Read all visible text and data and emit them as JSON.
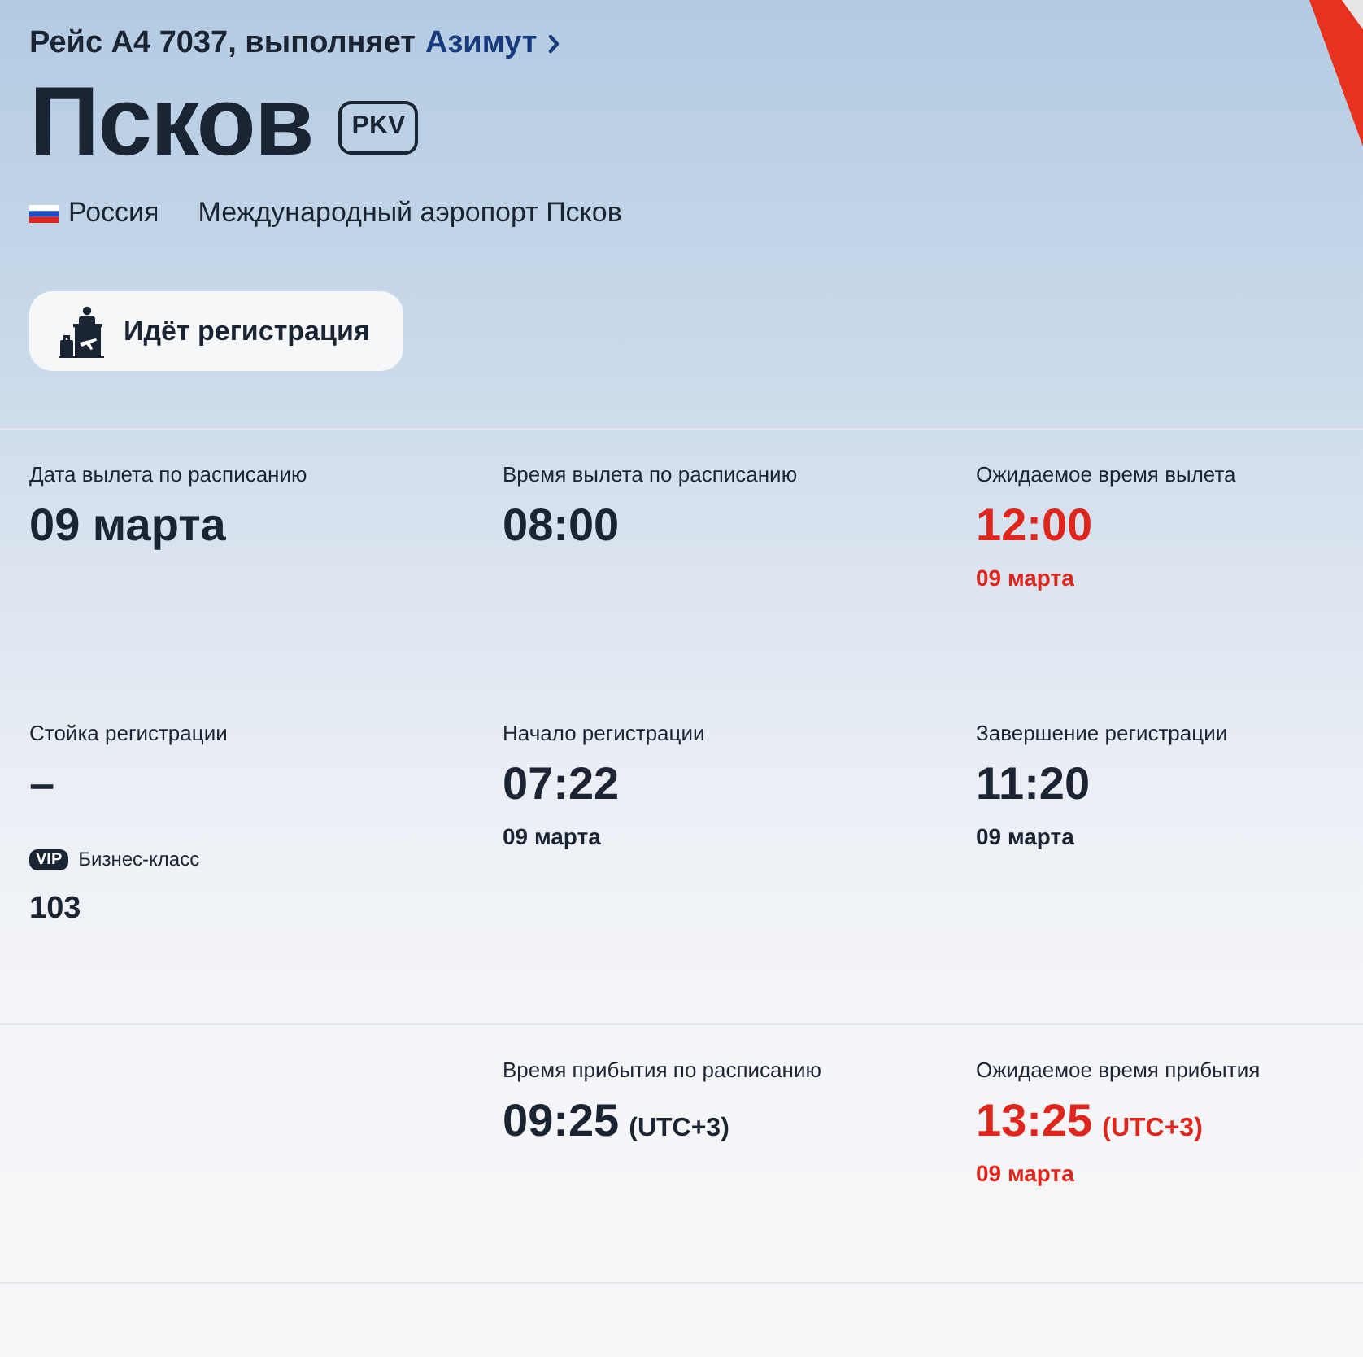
{
  "flight": {
    "text": "Рейс А4 7037, выполняет",
    "operator": "Азимут"
  },
  "city": {
    "name": "Псков",
    "code": "PKV"
  },
  "location": {
    "country": "Россия",
    "airport": "Международный аэропорт Псков"
  },
  "status": {
    "label": "Идёт регистрация"
  },
  "sections": [
    {
      "cells": [
        {
          "kind": "info",
          "label": "Дата вылета по расписанию",
          "value": "09 марта",
          "delayed": false
        },
        {
          "kind": "info",
          "label": "Время вылета по расписанию",
          "value": "08:00",
          "delayed": false
        },
        {
          "kind": "info",
          "label": "Ожидаемое время вылета",
          "value": "12:00",
          "date": "09 марта",
          "delayed": true
        }
      ]
    },
    {
      "cells": [
        {
          "kind": "info",
          "label": "Стойка регистрации",
          "value": "–",
          "delayed": false,
          "class_counter": {
            "badge": "VIP",
            "label": "Бизнес-класс",
            "value": "103"
          }
        },
        {
          "kind": "info",
          "label": "Начало регистрации",
          "value": "07:22",
          "date": "09 марта",
          "delayed": false
        },
        {
          "kind": "info",
          "label": "Завершение регистрации",
          "value": "11:20",
          "date": "09 марта",
          "delayed": false
        }
      ]
    },
    {
      "cells": [
        {
          "kind": "empty"
        },
        {
          "kind": "info",
          "label": "Время прибытия по расписанию",
          "value": "09:25",
          "timezone": "(UTC+3)",
          "delayed": false
        },
        {
          "kind": "info",
          "label": "Ожидаемое время прибытия",
          "value": "13:25",
          "timezone": "(UTC+3)",
          "date": "09 марта",
          "delayed": true
        }
      ]
    }
  ]
}
